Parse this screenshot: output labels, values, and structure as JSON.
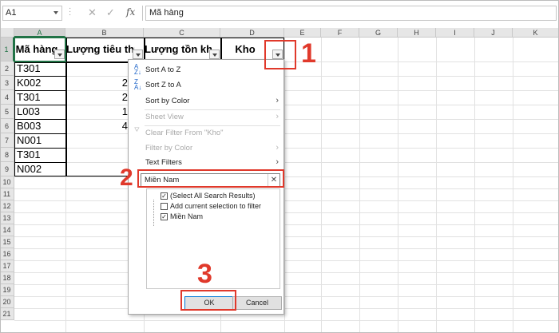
{
  "formula_bar": {
    "name_box": "A1",
    "cancel_icon": "✕",
    "enter_icon": "✓",
    "fx_label": "fx",
    "content": "Mã hàng"
  },
  "columns": [
    "A",
    "B",
    "C",
    "D",
    "E",
    "F",
    "G",
    "H",
    "I",
    "J",
    "K"
  ],
  "rows": [
    "1",
    "2",
    "3",
    "4",
    "5",
    "6",
    "7",
    "8",
    "9",
    "10",
    "11",
    "12",
    "13",
    "14",
    "15",
    "16",
    "17",
    "18",
    "19",
    "20",
    "21"
  ],
  "table": {
    "headers": [
      "Mã hàng",
      "Lượng tiêu thụ",
      "Lượng tồn kho",
      "Kho"
    ],
    "col_a": [
      "T301",
      "K002",
      "T301",
      "L003",
      "B003",
      "N001",
      "T301",
      "N002"
    ],
    "col_b_partial": [
      "",
      "2",
      "2",
      "1",
      "4",
      "",
      "",
      ""
    ]
  },
  "filter_menu": {
    "sort_az": "Sort A to Z",
    "sort_za": "Sort Z to A",
    "sort_by_color": "Sort by Color",
    "sheet_view": "Sheet View",
    "clear_filter": "Clear Filter From \"Kho\"",
    "filter_by_color": "Filter by Color",
    "text_filters": "Text Filters",
    "search_value": "Miền Nam",
    "search_clear": "✕",
    "list": {
      "select_all": "(Select All Search Results)",
      "add_selection": "Add current selection to filter",
      "mien_nam": "Miền Nam"
    },
    "ok_label": "OK",
    "cancel_label": "Cancel"
  },
  "annotations": {
    "step1": "1",
    "step2": "2",
    "step3": "3",
    "color": "#e0392b"
  },
  "colors": {
    "excel_green": "#217346",
    "selected_button_border": "#0078d7"
  }
}
